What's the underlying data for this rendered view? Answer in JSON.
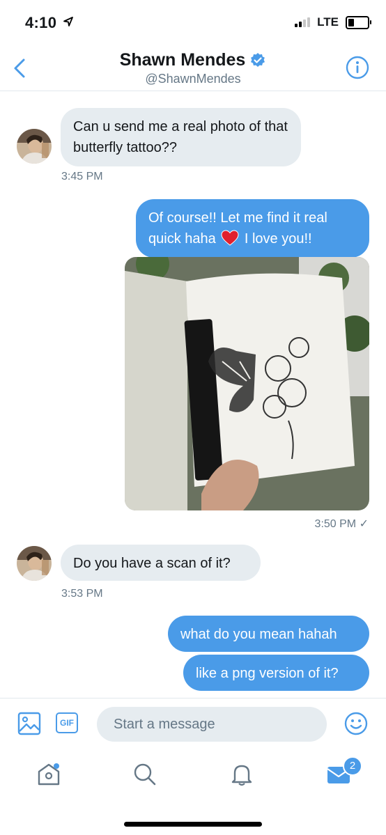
{
  "status_bar": {
    "time": "4:10",
    "network": "LTE"
  },
  "header": {
    "name": "Shawn Mendes",
    "handle": "@ShawnMendes"
  },
  "messages": [
    {
      "from": "them",
      "text": "Can u send me a real photo of that butterfly tattoo??",
      "time": "3:45 PM"
    },
    {
      "from": "me",
      "text_before_emoji": "Of course!! Let me find it real quick haha",
      "text_after_emoji": "I love you!!"
    },
    {
      "from": "me",
      "type": "image",
      "time": "3:50 PM",
      "status": "✓"
    },
    {
      "from": "them",
      "text": "Do you have a scan of it?",
      "time": "3:53 PM"
    },
    {
      "from": "me",
      "text": "what do you mean hahah"
    },
    {
      "from": "me",
      "text": "like a png version of it?"
    }
  ],
  "composer": {
    "placeholder": "Start a message",
    "gif_label": "GIF"
  },
  "tabbar": {
    "messages_badge": "2"
  },
  "colors": {
    "accent": "#4a9be8",
    "incoming_bubble": "#e6ecf0",
    "text": "#14171a",
    "muted": "#657786"
  }
}
